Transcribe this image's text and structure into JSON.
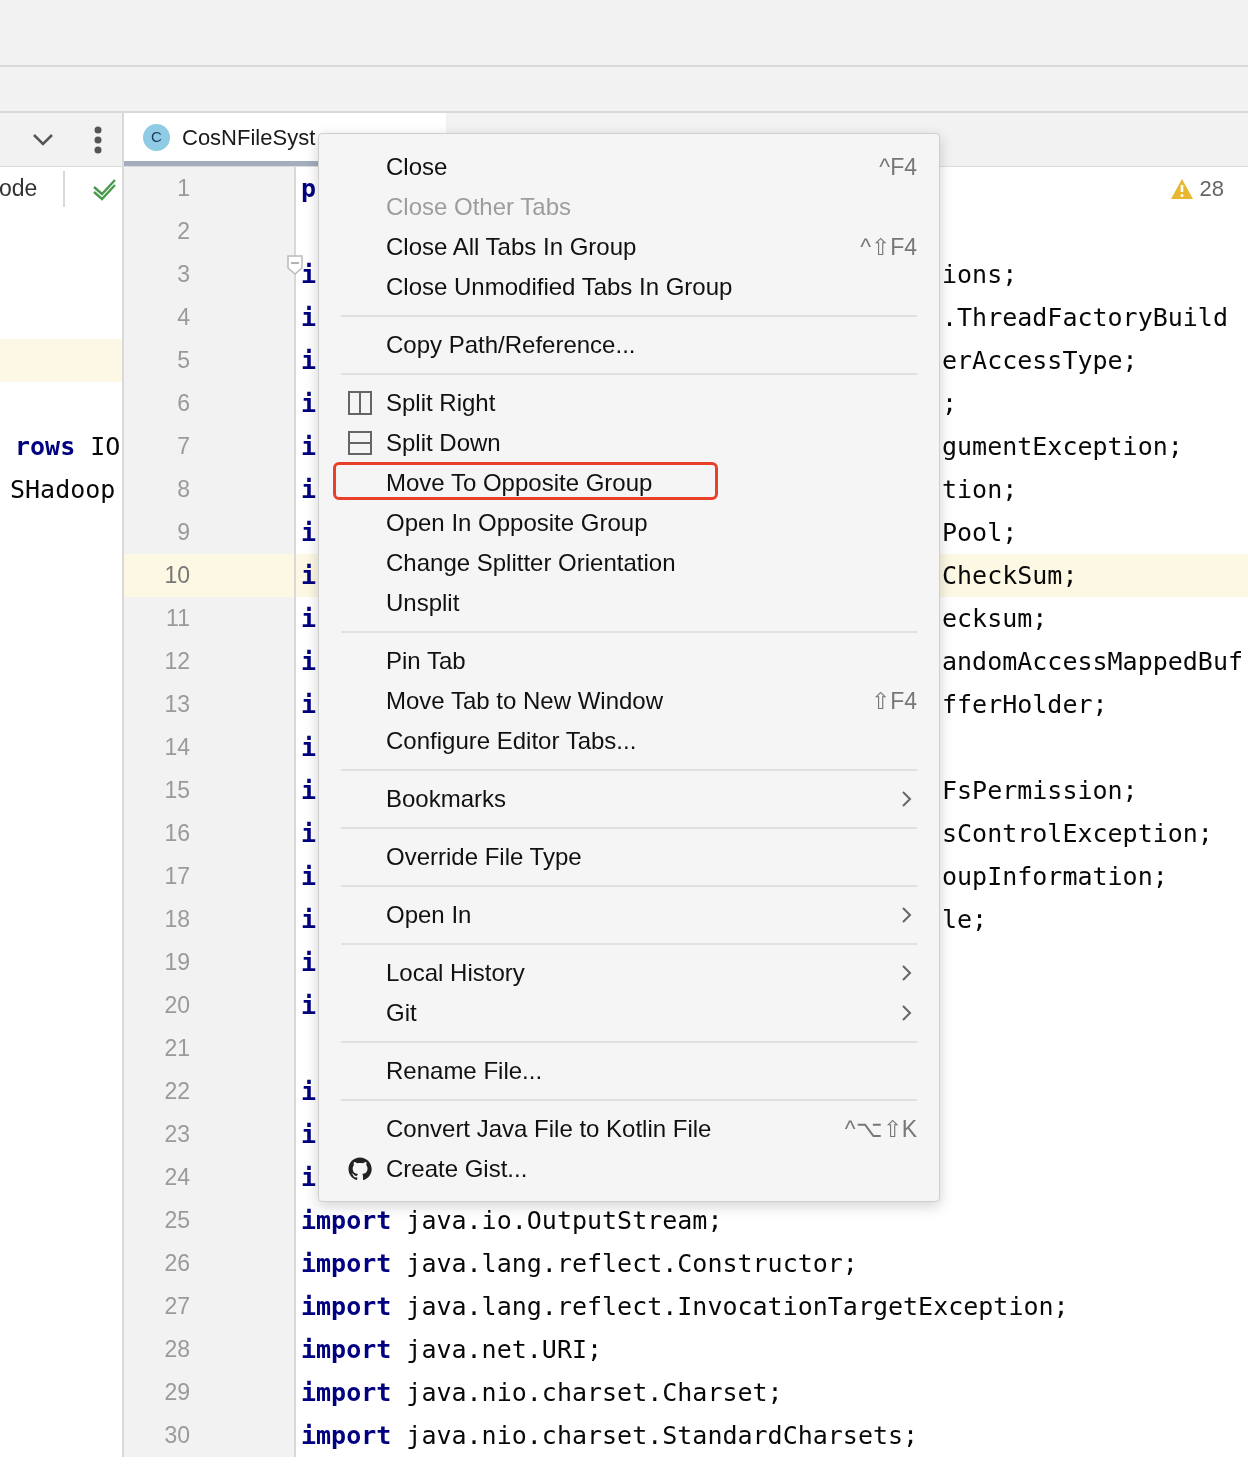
{
  "left_pane": {
    "toolbar_label": "ode",
    "rows": [
      {
        "highlighted": false
      },
      {
        "highlighted": false
      },
      {
        "highlighted": false
      },
      {
        "highlighted": true
      },
      {
        "highlighted": false
      },
      {
        "highlighted": false,
        "parts": [
          {
            "kind": "keyword",
            "text": "rows"
          },
          {
            "kind": "plain",
            "text": " IO"
          }
        ]
      },
      {
        "highlighted": false,
        "parts": [
          {
            "kind": "plain",
            "text": "SHadoop"
          }
        ]
      }
    ]
  },
  "tab": {
    "icon_letter": "C",
    "label": "CosNFileSyst",
    "selected": true
  },
  "warnings": "28",
  "editor_lines": [
    {
      "number": "1",
      "current": false,
      "fold": false,
      "parts": [
        {
          "kind": "keyword",
          "text": "p"
        }
      ]
    },
    {
      "number": "2",
      "current": false,
      "fold": false
    },
    {
      "number": "3",
      "current": false,
      "fold": true,
      "parts": [
        {
          "kind": "keyword",
          "text": "i"
        }
      ],
      "after_menu": "ions;"
    },
    {
      "number": "4",
      "current": false,
      "fold": false,
      "parts": [
        {
          "kind": "keyword",
          "text": "i"
        }
      ],
      "after_menu": ".ThreadFactoryBuild"
    },
    {
      "number": "5",
      "current": false,
      "fold": false,
      "parts": [
        {
          "kind": "keyword",
          "text": "i"
        }
      ],
      "after_menu": "erAccessType;"
    },
    {
      "number": "6",
      "current": false,
      "fold": false,
      "parts": [
        {
          "kind": "keyword",
          "text": "i"
        }
      ],
      "after_menu": ";"
    },
    {
      "number": "7",
      "current": false,
      "fold": false,
      "parts": [
        {
          "kind": "keyword",
          "text": "i"
        }
      ],
      "after_menu": "gumentException;"
    },
    {
      "number": "8",
      "current": false,
      "fold": false,
      "parts": [
        {
          "kind": "keyword",
          "text": "i"
        }
      ],
      "after_menu": "tion;"
    },
    {
      "number": "9",
      "current": false,
      "fold": false,
      "parts": [
        {
          "kind": "keyword",
          "text": "i"
        }
      ],
      "after_menu": "Pool;"
    },
    {
      "number": "10",
      "current": true,
      "fold": false,
      "parts": [
        {
          "kind": "keyword",
          "text": "i"
        }
      ],
      "after_menu": "CheckSum;"
    },
    {
      "number": "11",
      "current": false,
      "fold": false,
      "parts": [
        {
          "kind": "keyword",
          "text": "i"
        }
      ],
      "after_menu": "ecksum;"
    },
    {
      "number": "12",
      "current": false,
      "fold": false,
      "parts": [
        {
          "kind": "keyword",
          "text": "i"
        }
      ],
      "after_menu": "andomAccessMappedBuf"
    },
    {
      "number": "13",
      "current": false,
      "fold": false,
      "parts": [
        {
          "kind": "keyword",
          "text": "i"
        }
      ],
      "after_menu": "fferHolder;"
    },
    {
      "number": "14",
      "current": false,
      "fold": false,
      "parts": [
        {
          "kind": "keyword",
          "text": "i"
        }
      ]
    },
    {
      "number": "15",
      "current": false,
      "fold": false,
      "parts": [
        {
          "kind": "keyword",
          "text": "i"
        }
      ],
      "after_menu": "FsPermission;"
    },
    {
      "number": "16",
      "current": false,
      "fold": false,
      "parts": [
        {
          "kind": "keyword",
          "text": "i"
        }
      ],
      "after_menu": "sControlException;"
    },
    {
      "number": "17",
      "current": false,
      "fold": false,
      "parts": [
        {
          "kind": "keyword",
          "text": "i"
        }
      ],
      "after_menu": "oupInformation;"
    },
    {
      "number": "18",
      "current": false,
      "fold": false,
      "parts": [
        {
          "kind": "keyword",
          "text": "i"
        }
      ],
      "after_menu": "le;"
    },
    {
      "number": "19",
      "current": false,
      "fold": false,
      "parts": [
        {
          "kind": "keyword",
          "text": "i"
        }
      ]
    },
    {
      "number": "20",
      "current": false,
      "fold": false,
      "parts": [
        {
          "kind": "keyword",
          "text": "i"
        }
      ]
    },
    {
      "number": "21",
      "current": false,
      "fold": false
    },
    {
      "number": "22",
      "current": false,
      "fold": false,
      "parts": [
        {
          "kind": "keyword",
          "text": "i"
        }
      ]
    },
    {
      "number": "23",
      "current": false,
      "fold": false,
      "parts": [
        {
          "kind": "keyword",
          "text": "i"
        }
      ]
    },
    {
      "number": "24",
      "current": false,
      "fold": false,
      "parts": [
        {
          "kind": "keyword",
          "text": "i"
        }
      ]
    },
    {
      "number": "25",
      "current": false,
      "fold": false,
      "parts": [
        {
          "kind": "keyword",
          "text": "import"
        },
        {
          "kind": "plain",
          "text": " java.io.OutputStream;"
        }
      ]
    },
    {
      "number": "26",
      "current": false,
      "fold": false,
      "parts": [
        {
          "kind": "keyword",
          "text": "import"
        },
        {
          "kind": "plain",
          "text": " java.lang.reflect.Constructor;"
        }
      ]
    },
    {
      "number": "27",
      "current": false,
      "fold": false,
      "parts": [
        {
          "kind": "keyword",
          "text": "import"
        },
        {
          "kind": "plain",
          "text": " java.lang.reflect.InvocationTargetException;"
        }
      ]
    },
    {
      "number": "28",
      "current": false,
      "fold": false,
      "parts": [
        {
          "kind": "keyword",
          "text": "import"
        },
        {
          "kind": "plain",
          "text": " java.net.URI;"
        }
      ]
    },
    {
      "number": "29",
      "current": false,
      "fold": false,
      "parts": [
        {
          "kind": "keyword",
          "text": "import"
        },
        {
          "kind": "plain",
          "text": " java.nio.charset.Charset;"
        }
      ]
    },
    {
      "number": "30",
      "current": false,
      "fold": false,
      "parts": [
        {
          "kind": "keyword",
          "text": "import"
        },
        {
          "kind": "plain",
          "text": " java.nio.charset.StandardCharsets;"
        }
      ]
    }
  ],
  "context_menu": [
    {
      "kind": "item",
      "label": "Close",
      "shortcut": "^F4",
      "disabled": false,
      "highlighted": false
    },
    {
      "kind": "item",
      "label": "Close Other Tabs",
      "disabled": true,
      "highlighted": false
    },
    {
      "kind": "item",
      "label": "Close All Tabs In Group",
      "shortcut": "^⇧F4",
      "disabled": false,
      "highlighted": false
    },
    {
      "kind": "item",
      "label": "Close Unmodified Tabs In Group",
      "disabled": false,
      "highlighted": false
    },
    {
      "kind": "separator"
    },
    {
      "kind": "item",
      "label": "Copy Path/Reference...",
      "disabled": false,
      "highlighted": false
    },
    {
      "kind": "separator"
    },
    {
      "kind": "item",
      "label": "Split Right",
      "disabled": false,
      "highlighted": false
    },
    {
      "kind": "item",
      "label": "Split Down",
      "disabled": false,
      "highlighted": false
    },
    {
      "kind": "item",
      "label": "Move To Opposite Group",
      "disabled": false,
      "highlighted": true
    },
    {
      "kind": "item",
      "label": "Open In Opposite Group",
      "disabled": false,
      "highlighted": false
    },
    {
      "kind": "item",
      "label": "Change Splitter Orientation",
      "disabled": false,
      "highlighted": false
    },
    {
      "kind": "item",
      "label": "Unsplit",
      "disabled": false,
      "highlighted": false
    },
    {
      "kind": "separator"
    },
    {
      "kind": "item",
      "label": "Pin Tab",
      "disabled": false,
      "highlighted": false
    },
    {
      "kind": "item",
      "label": "Move Tab to New Window",
      "shortcut": "⇧F4",
      "disabled": false,
      "highlighted": false
    },
    {
      "kind": "item",
      "label": "Configure Editor Tabs...",
      "disabled": false,
      "highlighted": false
    },
    {
      "kind": "separator"
    },
    {
      "kind": "item",
      "label": "Bookmarks",
      "submenu": true,
      "disabled": false,
      "highlighted": false
    },
    {
      "kind": "separator"
    },
    {
      "kind": "item",
      "label": "Override File Type",
      "disabled": false,
      "highlighted": false
    },
    {
      "kind": "separator"
    },
    {
      "kind": "item",
      "label": "Open In",
      "submenu": true,
      "disabled": false,
      "highlighted": false
    },
    {
      "kind": "separator"
    },
    {
      "kind": "item",
      "label": "Local History",
      "submenu": true,
      "disabled": false,
      "highlighted": false
    },
    {
      "kind": "item",
      "label": "Git",
      "submenu": true,
      "disabled": false,
      "highlighted": false
    },
    {
      "kind": "separator"
    },
    {
      "kind": "item",
      "label": "Rename File...",
      "disabled": false,
      "highlighted": false
    },
    {
      "kind": "separator"
    },
    {
      "kind": "item",
      "label": "Convert Java File to Kotlin File",
      "shortcut": "^⌥⇧K",
      "disabled": false,
      "highlighted": false
    },
    {
      "kind": "item",
      "label": "Create Gist...",
      "disabled": false,
      "highlighted": false
    }
  ]
}
